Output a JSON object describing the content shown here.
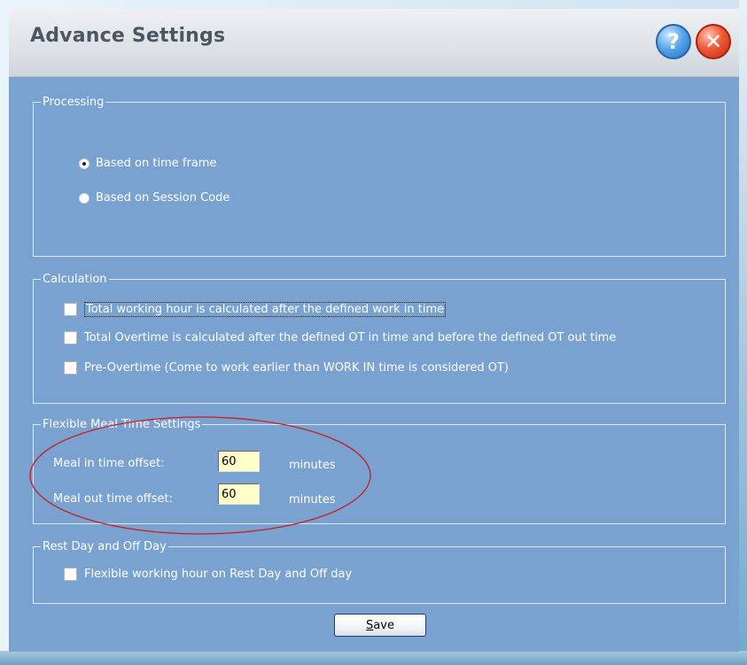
{
  "window": {
    "title": "Advance Settings",
    "help_glyph": "?",
    "close_glyph": "✕"
  },
  "processing": {
    "legend": "Processing",
    "options": [
      {
        "label": "Based on time frame",
        "selected": true
      },
      {
        "label": "Based on Session Code",
        "selected": false
      }
    ]
  },
  "calculation": {
    "legend": "Calculation",
    "options": [
      {
        "label": "Total working hour is calculated after the defined work in time",
        "checked": false
      },
      {
        "label": "Total Overtime is calculated after the defined OT in time and before the defined OT out time",
        "checked": false
      },
      {
        "label": "Pre-Overtime (Come to work earlier than WORK IN time is considered OT)",
        "checked": false
      }
    ]
  },
  "meal": {
    "legend": "Flexible Meal Time Settings",
    "in_label": "Meal in time offset:",
    "in_value": "60",
    "in_unit": "minutes",
    "out_label": "Meal out time offset:",
    "out_value": "60",
    "out_unit": "minutes"
  },
  "restday": {
    "legend": "Rest Day and Off Day",
    "option": {
      "label": "Flexible working hour on Rest Day and Off day",
      "checked": false
    }
  },
  "footer": {
    "save_key": "S",
    "save_rest": "ave"
  },
  "colors": {
    "window_bg": "#7aa2d0",
    "annotation": "#c81e1e"
  },
  "icons": {
    "help": "help-icon",
    "close": "close-icon"
  }
}
